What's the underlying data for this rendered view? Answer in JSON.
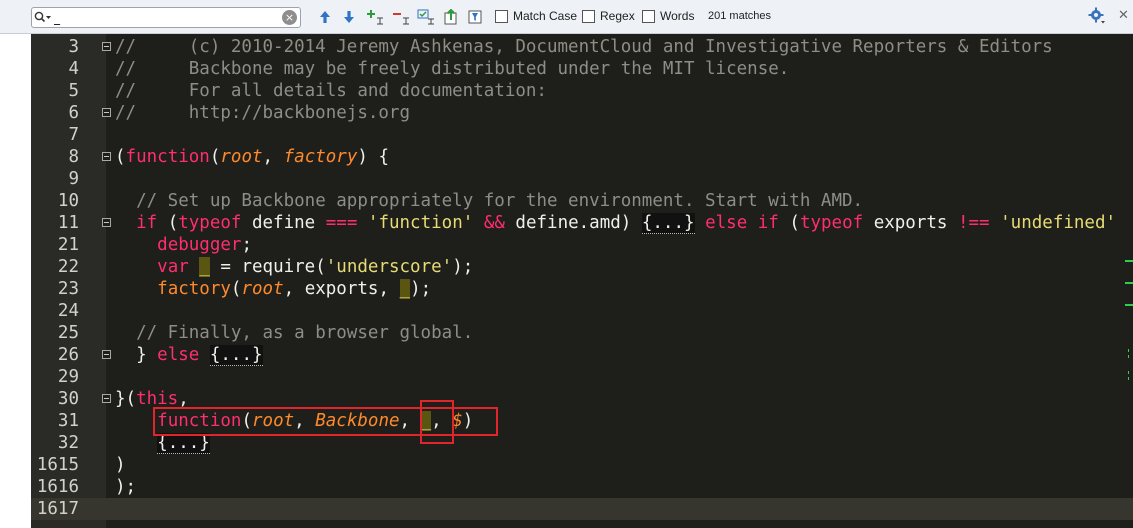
{
  "search": {
    "value": "_",
    "clear_icon": "clear-icon",
    "match_case_label": "Match Case",
    "regex_label": "Regex",
    "words_label": "Words",
    "match_count": "201 matches"
  },
  "editor": {
    "current_line": "1617",
    "lines": [
      {
        "n": "3",
        "fold": true,
        "code": [
          [
            "cm",
            "//     (c) 2010-2014 Jeremy Ashkenas, DocumentCloud and Investigative Reporters & Editors"
          ]
        ]
      },
      {
        "n": "4",
        "fold": false,
        "code": [
          [
            "cm",
            "//     Backbone may be freely distributed under the MIT license."
          ]
        ]
      },
      {
        "n": "5",
        "fold": false,
        "code": [
          [
            "cm",
            "//     For all details and documentation:"
          ]
        ]
      },
      {
        "n": "6",
        "fold": true,
        "code": [
          [
            "cm",
            "//     http://backbonejs.org"
          ]
        ]
      },
      {
        "n": "7",
        "fold": false,
        "code": []
      },
      {
        "n": "8",
        "fold": true,
        "code": [
          [
            "pl",
            "("
          ],
          [
            "kw",
            "function"
          ],
          [
            "pl",
            "("
          ],
          [
            "pa",
            "root"
          ],
          [
            "pl",
            ", "
          ],
          [
            "pa",
            "factory"
          ],
          [
            "pl",
            ") {"
          ]
        ]
      },
      {
        "n": "9",
        "fold": false,
        "code": []
      },
      {
        "n": "10",
        "fold": false,
        "code": [
          [
            "pl",
            "  "
          ],
          [
            "cm",
            "// Set up Backbone appropriately for the environment. Start with AMD."
          ]
        ]
      },
      {
        "n": "11",
        "fold": true,
        "code": [
          [
            "pl",
            "  "
          ],
          [
            "kw",
            "if"
          ],
          [
            "pl",
            " ("
          ],
          [
            "kw",
            "typeof"
          ],
          [
            "pl",
            " define "
          ],
          [
            "op",
            "==="
          ],
          [
            "pl",
            " "
          ],
          [
            "st",
            "'function'"
          ],
          [
            "pl",
            " "
          ],
          [
            "op",
            "&&"
          ],
          [
            "pl",
            " define.amd) "
          ],
          [
            "fd",
            "{...}"
          ],
          [
            "pl",
            " "
          ],
          [
            "kw",
            "else if"
          ],
          [
            "pl",
            " ("
          ],
          [
            "kw",
            "typeof"
          ],
          [
            "pl",
            " exports "
          ],
          [
            "op",
            "!=="
          ],
          [
            "pl",
            " "
          ],
          [
            "st",
            "'undefined'"
          ]
        ]
      },
      {
        "n": "21",
        "fold": false,
        "code": [
          [
            "pl",
            "    "
          ],
          [
            "kw",
            "debugger"
          ],
          [
            "pl",
            ";"
          ]
        ]
      },
      {
        "n": "22",
        "fold": false,
        "code": [
          [
            "pl",
            "    "
          ],
          [
            "kw",
            "var"
          ],
          [
            "pl",
            " "
          ],
          [
            "hl",
            "_"
          ],
          [
            "pl",
            " = require("
          ],
          [
            "st",
            "'underscore'"
          ],
          [
            "pl",
            ");"
          ]
        ]
      },
      {
        "n": "23",
        "fold": false,
        "code": [
          [
            "pl",
            "    "
          ],
          [
            "fn",
            "factory"
          ],
          [
            "pl",
            "("
          ],
          [
            "pa",
            "root"
          ],
          [
            "pl",
            ", exports, "
          ],
          [
            "hl",
            "_"
          ],
          [
            "pl",
            ");"
          ]
        ]
      },
      {
        "n": "24",
        "fold": false,
        "code": []
      },
      {
        "n": "25",
        "fold": false,
        "code": [
          [
            "pl",
            "  "
          ],
          [
            "cm",
            "// Finally, as a browser global."
          ]
        ]
      },
      {
        "n": "26",
        "fold": true,
        "code": [
          [
            "pl",
            "  } "
          ],
          [
            "kw",
            "else"
          ],
          [
            "pl",
            " "
          ],
          [
            "fd",
            "{...}"
          ]
        ]
      },
      {
        "n": "29",
        "fold": false,
        "code": []
      },
      {
        "n": "30",
        "fold": true,
        "code": [
          [
            "pl",
            "}("
          ],
          [
            "kw",
            "this"
          ],
          [
            "pl",
            ","
          ]
        ]
      },
      {
        "n": "31",
        "fold": false,
        "code": [
          [
            "pl",
            "    "
          ],
          [
            "kw",
            "function"
          ],
          [
            "pl",
            "("
          ],
          [
            "pa",
            "root"
          ],
          [
            "pl",
            ", "
          ],
          [
            "pa",
            "Backbone"
          ],
          [
            "pl",
            ", "
          ],
          [
            "hl",
            "_"
          ],
          [
            "pl",
            ", "
          ],
          [
            "pa",
            "$"
          ],
          [
            "pl",
            ")"
          ]
        ]
      },
      {
        "n": "32",
        "fold": false,
        "code": [
          [
            "pl",
            "    "
          ],
          [
            "fd",
            "{...}"
          ]
        ]
      },
      {
        "n": "1615",
        "fold": false,
        "code": [
          [
            "pl",
            ")"
          ]
        ]
      },
      {
        "n": "1616",
        "fold": false,
        "code": [
          [
            "pl",
            ");"
          ]
        ]
      },
      {
        "n": "1617",
        "fold": false,
        "code": []
      }
    ]
  }
}
